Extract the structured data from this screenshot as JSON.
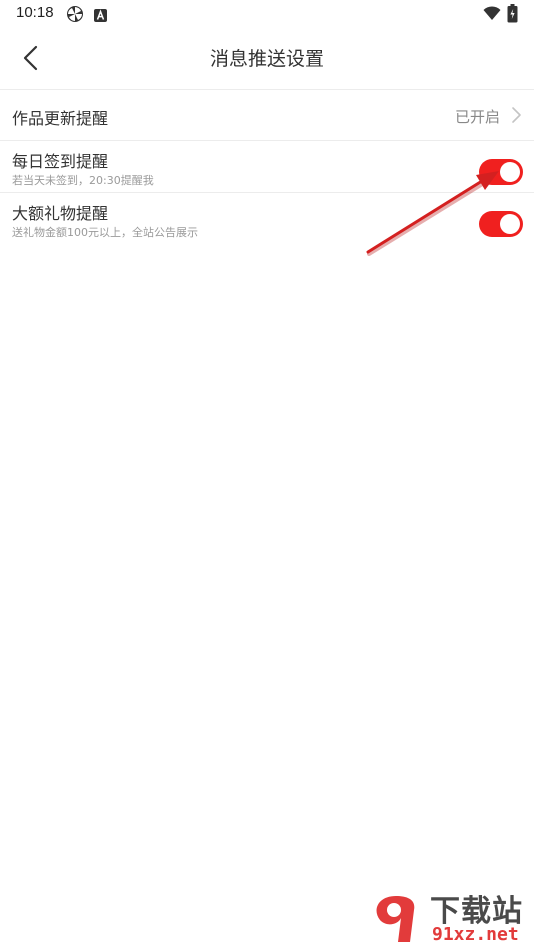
{
  "status_bar": {
    "time": "10:18",
    "icons": [
      "pinwheel-icon",
      "app-a-icon",
      "wifi-icon",
      "battery-charging-icon"
    ]
  },
  "header": {
    "title": "消息推送设置",
    "back_icon": "chevron-left-icon"
  },
  "settings": [
    {
      "label": "作品更新提醒",
      "status": "已开启",
      "type": "link"
    },
    {
      "label": "每日签到提醒",
      "subtitle": "若当天未签到，20:30提醒我",
      "type": "toggle",
      "enabled": true
    },
    {
      "label": "大额礼物提醒",
      "subtitle": "送礼物金额100元以上，全站公告展示",
      "type": "toggle",
      "enabled": true
    }
  ],
  "colors": {
    "toggle_on": "#f0201f",
    "annotation_arrow": "#d42020",
    "divider": "#ececec"
  },
  "watermark": {
    "big_text": "下载站",
    "small_text": "91xz.net"
  }
}
